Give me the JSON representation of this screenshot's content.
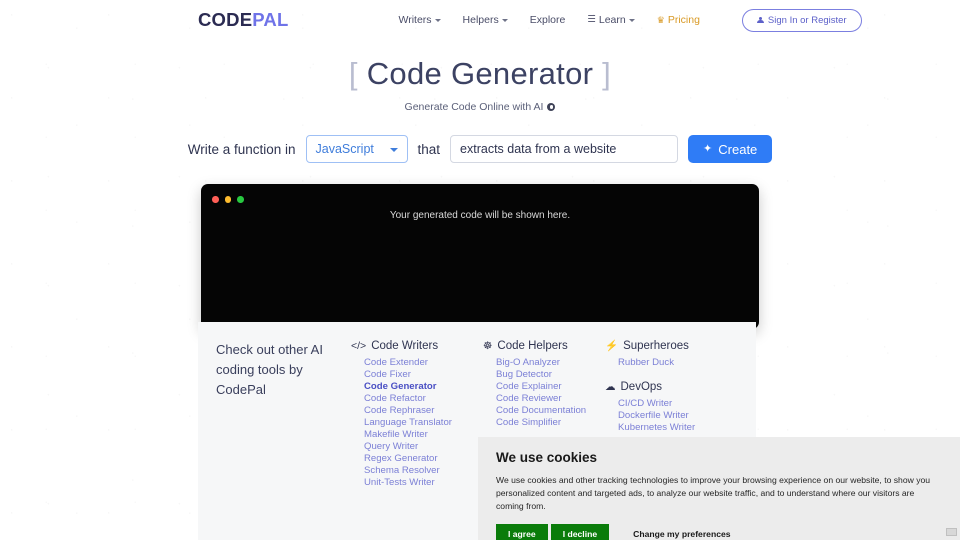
{
  "header": {
    "logo": {
      "part1": "CODE",
      "part2": "PAL"
    },
    "nav": [
      {
        "label": "Writers",
        "caret": true,
        "icon": null,
        "style": "normal"
      },
      {
        "label": "Helpers",
        "caret": true,
        "icon": null,
        "style": "normal"
      },
      {
        "label": "Explore",
        "caret": false,
        "icon": null,
        "style": "normal"
      },
      {
        "label": "Learn",
        "caret": true,
        "icon": "☰",
        "style": "normal"
      },
      {
        "label": "Pricing",
        "caret": false,
        "icon": "♛",
        "style": "pricing"
      }
    ],
    "signin_label": "Sign In or Register",
    "signin_icon": "person-icon"
  },
  "hero": {
    "bracket_left": "[",
    "title": "Code Generator",
    "bracket_right": "]",
    "subtitle": "Generate Code Online with AI",
    "info_icon": "info-circle-icon"
  },
  "prompt": {
    "label_before": "Write a function in",
    "language_value": "JavaScript",
    "label_after": "that",
    "task_value": "extracts data from a website",
    "task_placeholder": "extracts data from a website",
    "create_label": "Create",
    "create_icon": "sparkle-icon",
    "accent_color": "#2f7cf6"
  },
  "code_panel": {
    "placeholder": "Your generated code will be shown here.",
    "dot_colors": [
      "#ff5f57",
      "#febc2e",
      "#28c840"
    ],
    "background": "#050505"
  },
  "tools": {
    "intro": "Check out other AI coding tools by CodePal",
    "groups": [
      {
        "title": "Code Writers",
        "icon": "code-brackets-icon",
        "glyph": "</>",
        "column": "writers",
        "items": [
          {
            "label": "Code Extender",
            "active": false
          },
          {
            "label": "Code Fixer",
            "active": false
          },
          {
            "label": "Code Generator",
            "active": true
          },
          {
            "label": "Code Refactor",
            "active": false
          },
          {
            "label": "Code Rephraser",
            "active": false
          },
          {
            "label": "Language Translator",
            "active": false
          },
          {
            "label": "Makefile Writer",
            "active": false
          },
          {
            "label": "Query Writer",
            "active": false
          },
          {
            "label": "Regex Generator",
            "active": false
          },
          {
            "label": "Schema Resolver",
            "active": false
          },
          {
            "label": "Unit-Tests Writer",
            "active": false
          }
        ]
      },
      {
        "title": "Code Helpers",
        "icon": "life-ring-icon",
        "glyph": "☸",
        "column": "helpers",
        "items": [
          {
            "label": "Big-O Analyzer",
            "active": false
          },
          {
            "label": "Bug Detector",
            "active": false
          },
          {
            "label": "Code Explainer",
            "active": false
          },
          {
            "label": "Code Reviewer",
            "active": false
          },
          {
            "label": "Code Documentation",
            "active": false
          },
          {
            "label": "Code Simplifier",
            "active": false
          }
        ]
      },
      {
        "title": "Superheroes",
        "icon": "lightning-bolt-icon",
        "glyph": "⚡",
        "column": "heroes",
        "items": [
          {
            "label": "Rubber Duck",
            "active": false
          }
        ]
      },
      {
        "title": "DevOps",
        "icon": "cloud-icon",
        "glyph": "☁",
        "column": "heroes",
        "spaced": true,
        "items": [
          {
            "label": "CI/CD Writer",
            "active": false
          },
          {
            "label": "Dockerfile Writer",
            "active": false
          },
          {
            "label": "Kubernetes Writer",
            "active": false
          }
        ]
      }
    ]
  },
  "cookies": {
    "title": "We use cookies",
    "body": "We use cookies and other tracking technologies to improve your browsing experience on our website, to show you personalized content and targeted ads, to analyze our website traffic, and to understand where our visitors are coming from.",
    "agree_label": "I agree",
    "decline_label": "I decline",
    "prefs_label": "Change my preferences",
    "button_color": "#0a7c0a"
  }
}
